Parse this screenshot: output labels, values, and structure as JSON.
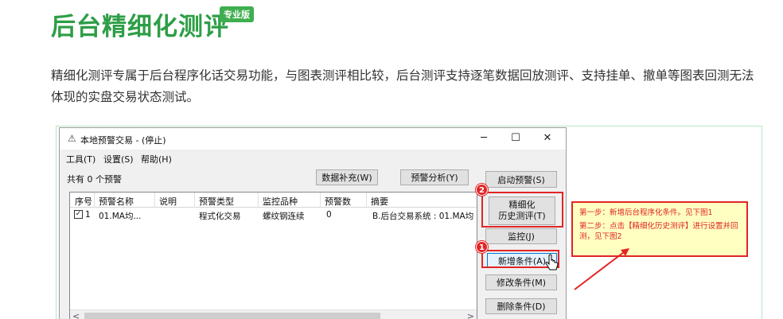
{
  "header": {
    "title": "后台精细化测评",
    "badge": "专业版",
    "intro": "精细化测评专属于后台程序化话交易功能，与图表测评相比较，后台测评支持逐笔数据回放测评、支持挂单、撤单等图表回测无法体现的实盘交易状态测试。"
  },
  "window": {
    "title": "本地预警交易 - (停止)",
    "controls": {
      "minimize": "─",
      "maximize": "☐",
      "close": "✕"
    },
    "menu": [
      "工具(T)",
      "设置(S)",
      "帮助(H)"
    ],
    "count_label": "共有 0 个预警",
    "toolbar": {
      "data_fill": "数据补充(W)",
      "warning_analysis": "预警分析(Y)"
    },
    "side_buttons": {
      "start": "启动预警(S)",
      "refine_line1": "精细化",
      "refine_line2": "历史测评(T)",
      "monitor": "监控(J)",
      "add": "新增条件(A)",
      "modify": "修改条件(M)",
      "delete": "删除条件(D)"
    },
    "table": {
      "columns": [
        "序号",
        "预警名称",
        "说明",
        "预警类型",
        "监控品种",
        "预警数",
        "摘要"
      ],
      "rows": [
        {
          "checked": true,
          "index": "1",
          "name": "01.MA均...",
          "desc": "",
          "type": "程式化交易",
          "symbol": "螺纹钢连续",
          "count": "0",
          "summary": "B.后台交易系统 : 01.MA均"
        }
      ]
    },
    "scroll": {
      "left": "<",
      "right": ">"
    }
  },
  "annotations": {
    "step1_num": "1",
    "step2_num": "2",
    "note_line1": "第一步：新增后台程序化条件。见下图1",
    "note_line2": "第二步：点击【精细化历史测评】进行设置并回测，见下图2",
    "accent_color": "#e12525",
    "title_color": "#2e9e46"
  }
}
